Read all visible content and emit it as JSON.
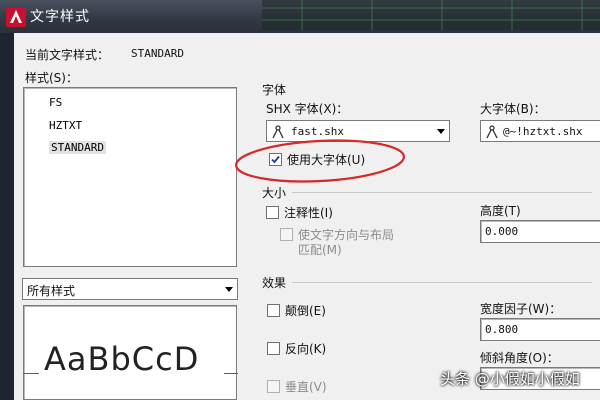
{
  "window": {
    "title": "文字样式",
    "app_icon": "autocad-a-icon"
  },
  "current_style": {
    "label": "当前文字样式：",
    "value": "STANDARD"
  },
  "styles_panel": {
    "label": "样式(S)：",
    "items": [
      "FS",
      "HZTXT",
      "STANDARD"
    ],
    "selected": "STANDARD",
    "filter_value": "所有样式"
  },
  "preview": {
    "text": "AaBbCcD"
  },
  "font": {
    "group_label": "字体",
    "shx_label": "SHX 字体(X)：",
    "shx_value": "fast.shx",
    "bigfont_label": "大字体(B)：",
    "bigfont_value": "@~!hztxt.shx",
    "use_bigfont_label": "使用大字体(U)",
    "use_bigfont_checked": true
  },
  "size": {
    "group_label": "大小",
    "annotative_label": "注释性(I)",
    "match_orientation_label_line1": "使文字方向与布局",
    "match_orientation_label_line2": "匹配(M)",
    "height_label": "高度(T)",
    "height_value": "0.000"
  },
  "effects": {
    "group_label": "效果",
    "upside_down_label": "颠倒(E)",
    "backwards_label": "反向(K)",
    "vertical_label": "垂直(V)",
    "width_factor_label": "宽度因子(W)：",
    "width_factor_value": "0.800",
    "oblique_label": "倾斜角度(O)："
  },
  "watermark": {
    "text": "头条 @小假如小假如"
  },
  "colors": {
    "annotation_circle": "#d42a2a",
    "title_bar": "#303844",
    "dialog_bg": "#f0f0f0"
  }
}
